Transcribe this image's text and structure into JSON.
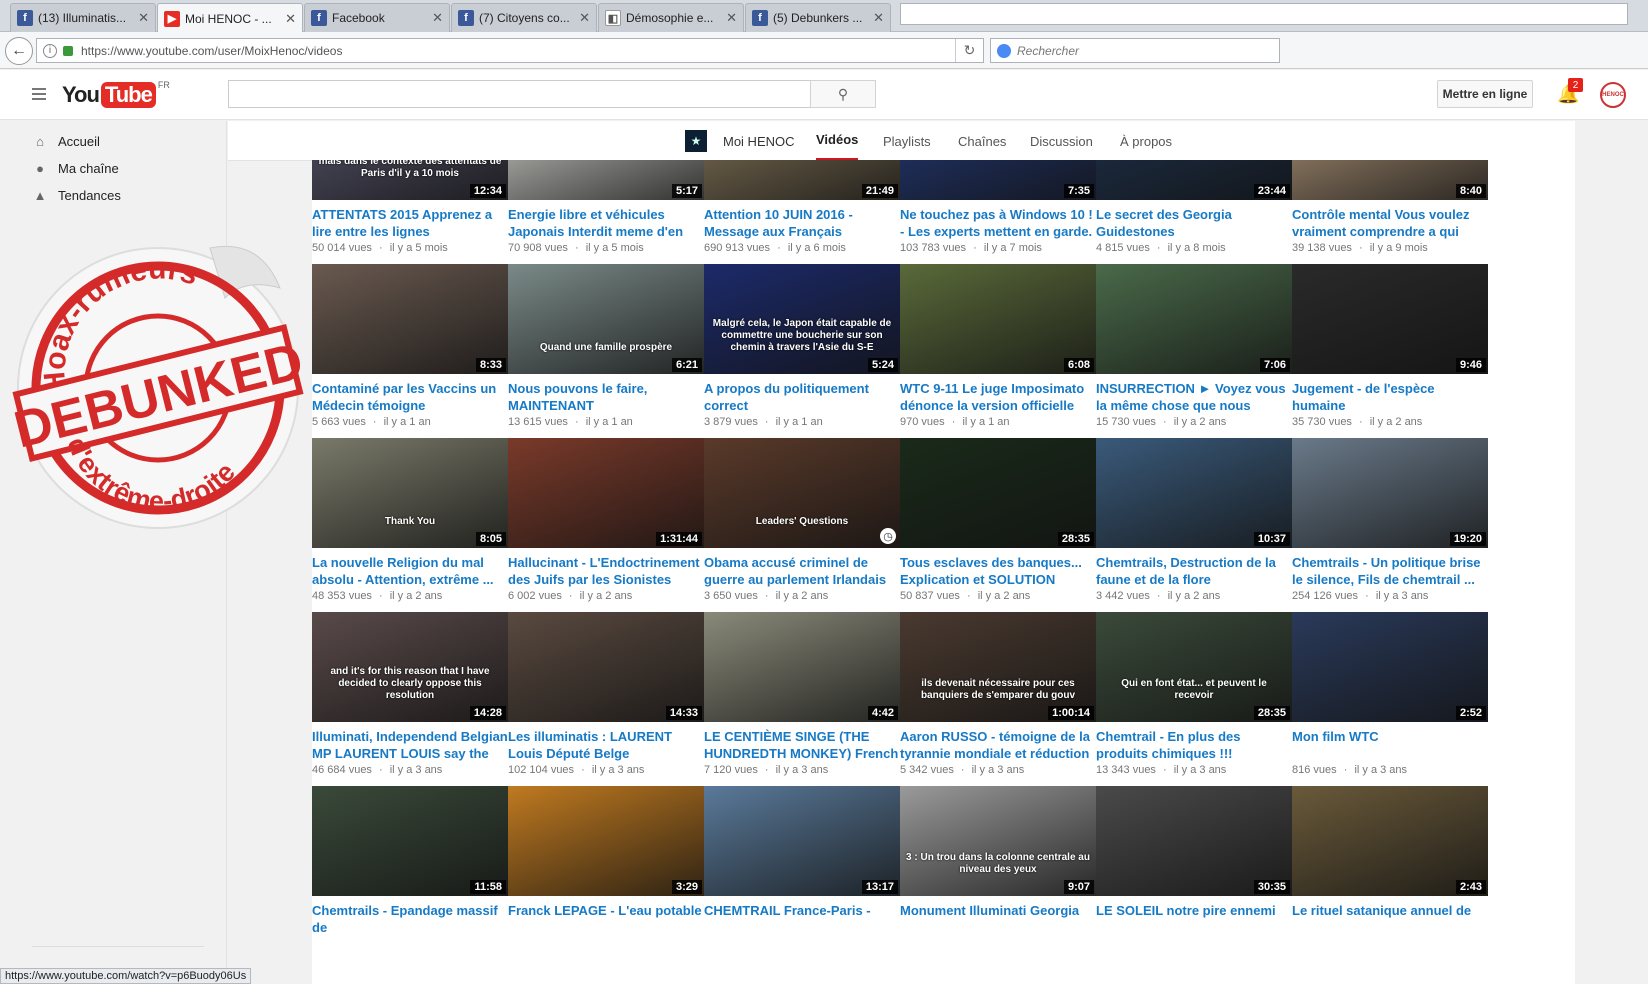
{
  "browser": {
    "tabs": [
      {
        "title": "(13) Illuminatis...",
        "icon": "facebook-icon"
      },
      {
        "title": "Moi HENOC - ...",
        "icon": "youtube-icon"
      },
      {
        "title": "Facebook",
        "icon": "facebook-icon"
      },
      {
        "title": "(7) Citoyens co...",
        "icon": "facebook-icon"
      },
      {
        "title": "Démosophie e...",
        "icon": "document-icon"
      },
      {
        "title": "(5) Debunkers ...",
        "icon": "facebook-icon"
      }
    ],
    "url": "https://www.youtube.com/user/MoixHenoc/videos",
    "search_placeholder": "Rechercher",
    "status_url": "https://www.youtube.com/watch?v=p6Buody06Us"
  },
  "youtube": {
    "logo_you": "You",
    "logo_tube": "Tube",
    "logo_region": "FR",
    "upload_label": "Mettre en ligne",
    "notification_count": "2",
    "avatar_text": "HENOC",
    "sidebar": [
      {
        "label": "Accueil",
        "icon": "home-icon"
      },
      {
        "label": "Ma chaîne",
        "icon": "account-icon"
      },
      {
        "label": "Tendances",
        "icon": "flame-icon"
      }
    ],
    "channel": {
      "name": "Moi HENOC",
      "tabs": [
        "Vidéos",
        "Playlists",
        "Chaînes",
        "Discussion",
        "À propos"
      ],
      "active_tab": "Vidéos"
    }
  },
  "stamp": {
    "top_text": "Hoax-rumeurs",
    "center_text": "DEBUNKED",
    "bottom_text": "d'extrême-droite",
    "color": "#d42a2a"
  },
  "videos": [
    {
      "title": "ATTENTATS 2015 Apprenez a lire entre les lignes",
      "views": "50 014 vues",
      "age": "il y a 5 mois",
      "duration": "12:34",
      "bg": "#5a5870",
      "overlay": "mais dans le contexte des attentats de Paris d'il y a 10 mois"
    },
    {
      "title": "Energie libre et véhicules Japonais Interdit meme d'en",
      "views": "70 908 vues",
      "age": "il y a 5 mois",
      "duration": "5:17",
      "bg": "#d8dad4",
      "overlay": ""
    },
    {
      "title": "Attention 10 JUIN 2016 - Message aux Français",
      "views": "690 913 vues",
      "age": "il y a 6 mois",
      "duration": "21:49",
      "bg": "#8a7a5c",
      "overlay": ""
    },
    {
      "title": "Ne touchez pas à Windows 10 ! - Les experts mettent en garde.",
      "views": "103 783 vues",
      "age": "il y a 7 mois",
      "duration": "7:35",
      "bg": "#243a7a",
      "overlay": ""
    },
    {
      "title": "Le secret des Georgia Guidestones",
      "views": "4 815 vues",
      "age": "il y a 8 mois",
      "duration": "23:44",
      "bg": "#1f3350",
      "overlay": ""
    },
    {
      "title": "Contrôle mental Vous voulez vraiment comprendre a qui vous ...",
      "views": "39 138 vues",
      "age": "il y a 9 mois",
      "duration": "8:40",
      "bg": "#b59a7c",
      "overlay": ""
    },
    {
      "title": "Contaminé par les Vaccins un Médecin témoigne",
      "views": "5 663 vues",
      "age": "il y a 1 an",
      "duration": "8:33",
      "bg": "#6a5a50",
      "overlay": ""
    },
    {
      "title": "Nous pouvons le faire, MAINTENANT",
      "views": "13 615 vues",
      "age": "il y a 1 an",
      "duration": "6:21",
      "bg": "#7a8a88",
      "overlay": "Quand une famille prospère"
    },
    {
      "title": "A propos du politiquement correct",
      "views": "3 879 vues",
      "age": "il y a 1 an",
      "duration": "5:24",
      "bg": "#1c2a6a",
      "overlay": "Malgré cela, le Japon était capable de commettre une boucherie sur son chemin à travers l'Asie du S-E"
    },
    {
      "title": "WTC 9-11 Le juge Imposimato dénonce la version officielle",
      "views": "970 vues",
      "age": "il y a 1 an",
      "duration": "6:08",
      "bg": "#5a6a3a",
      "overlay": ""
    },
    {
      "title": "INSURRECTION ► Voyez vous la même chose que nous",
      "views": "15 730 vues",
      "age": "il y a 2 ans",
      "duration": "7:06",
      "bg": "#4a6a4a",
      "overlay": ""
    },
    {
      "title": "Jugement - de l'espèce humaine",
      "views": "35 730 vues",
      "age": "il y a 2 ans",
      "duration": "9:46",
      "bg": "#2a2a2a",
      "overlay": ""
    },
    {
      "title": "La nouvelle Religion du mal absolu - Attention, extrême ...",
      "views": "48 353 vues",
      "age": "il y a 2 ans",
      "duration": "8:05",
      "bg": "#7a7a6a",
      "overlay": "Thank You"
    },
    {
      "title": "Hallucinant - L'Endoctrinement des Juifs par les Sionistes",
      "views": "6 002 vues",
      "age": "il y a 2 ans",
      "duration": "1:31:44",
      "bg": "#7a3a2a",
      "overlay": ""
    },
    {
      "title": "Obama accusé criminel de guerre au parlement Irlandais",
      "views": "3 650 vues",
      "age": "il y a 2 ans",
      "duration": "",
      "bg": "#5a3a2a",
      "overlay": "Leaders' Questions"
    },
    {
      "title": "Tous esclaves des banques... Explication et SOLUTION",
      "views": "50 837 vues",
      "age": "il y a 2 ans",
      "duration": "28:35",
      "bg": "#1a2a1a",
      "overlay": ""
    },
    {
      "title": "Chemtrails, Destruction de la faune et de la flore",
      "views": "3 442 vues",
      "age": "il y a 2 ans",
      "duration": "10:37",
      "bg": "#3a5a7a",
      "overlay": ""
    },
    {
      "title": "Chemtrails - Un politique brise le silence, Fils de chemtrail ...",
      "views": "254 126 vues",
      "age": "il y a 3 ans",
      "duration": "19:20",
      "bg": "#6a7a8a",
      "overlay": ""
    },
    {
      "title": "Illuminati, Independend Belgian MP LAURENT LOUIS say the tru...",
      "views": "46 684 vues",
      "age": "il y a 3 ans",
      "duration": "14:28",
      "bg": "#5a4a4a",
      "overlay": "and it's for this reason that I have decided to clearly oppose this resolution"
    },
    {
      "title": "Les illuminatis : LAURENT Louis Député Belge Indépendant dit la...",
      "views": "102 104 vues",
      "age": "il y a 3 ans",
      "duration": "14:33",
      "bg": "#5a4a40",
      "overlay": ""
    },
    {
      "title": "LE CENTIÈME SINGE (THE HUNDREDTH MONKEY) French ...",
      "views": "7 120 vues",
      "age": "il y a 3 ans",
      "duration": "4:42",
      "bg": "#8a8a7a",
      "overlay": ""
    },
    {
      "title": "Aaron RUSSO - témoigne de la tyrannie mondiale et réduction d...",
      "views": "5 342 vues",
      "age": "il y a 3 ans",
      "duration": "1:00:14",
      "bg": "#4a3a30",
      "overlay": "ils devenait nécessaire pour ces banquiers de s'emparer du gouv"
    },
    {
      "title": "Chemtrail - En plus des produits chimiques !!!",
      "views": "13 343 vues",
      "age": "il y a 3 ans",
      "duration": "28:35",
      "bg": "#3a4a3a",
      "overlay": "Qui en font état... et peuvent le recevoir"
    },
    {
      "title": "Mon film WTC",
      "views": "816 vues",
      "age": "il y a 3 ans",
      "duration": "2:52",
      "bg": "#2a3a5a",
      "overlay": ""
    },
    {
      "title": "Chemtrails - Epandage massif de",
      "views": "",
      "age": "",
      "duration": "11:58",
      "bg": "#3a4a3a",
      "overlay": ""
    },
    {
      "title": "Franck LEPAGE - L'eau potable",
      "views": "",
      "age": "",
      "duration": "3:29",
      "bg": "#c07a20",
      "overlay": ""
    },
    {
      "title": "CHEMTRAIL France-Paris -",
      "views": "",
      "age": "",
      "duration": "13:17",
      "bg": "#5a7a9a",
      "overlay": ""
    },
    {
      "title": "Monument Illuminati Georgia",
      "views": "",
      "age": "",
      "duration": "9:07",
      "bg": "#9a9a9a",
      "overlay": "3 : Un trou dans la colonne centrale au niveau des yeux"
    },
    {
      "title": "LE SOLEIL notre pire ennemi",
      "views": "",
      "age": "",
      "duration": "30:35",
      "bg": "#4a4a4a",
      "overlay": ""
    },
    {
      "title": "Le rituel satanique annuel de",
      "views": "",
      "age": "",
      "duration": "2:43",
      "bg": "#6a5a3a",
      "overlay": ""
    }
  ]
}
